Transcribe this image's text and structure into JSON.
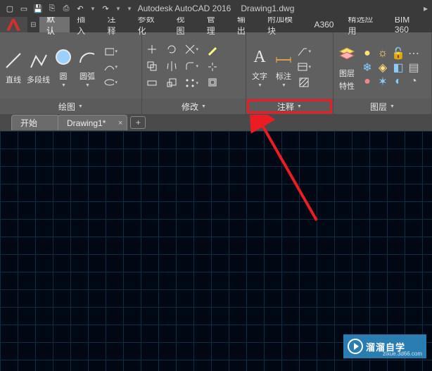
{
  "titlebar": {
    "app": "Autodesk AutoCAD 2016",
    "file": "Drawing1.dwg"
  },
  "menus": {
    "default": "默认",
    "insert": "插入",
    "annotate": "注释",
    "param": "参数化",
    "view": "视图",
    "manage": "管理",
    "output": "输出",
    "addon": "附加模块",
    "a360": "A360",
    "featured": "精选应用",
    "bim360": "BIM 360"
  },
  "ribbon": {
    "draw": {
      "line": "直线",
      "polyline": "多段线",
      "circle": "圆",
      "arc": "圆弧",
      "panel": "绘图"
    },
    "modify": {
      "panel": "修改"
    },
    "annotation": {
      "text": "文字",
      "dim": "标注",
      "panel": "注释"
    },
    "layer": {
      "label": "图层",
      "prop": "特性",
      "panel": "图层"
    }
  },
  "doctabs": {
    "start": "开始",
    "drawing": "Drawing1*"
  },
  "watermark": {
    "title": "溜溜自学",
    "sub": "zixue.3d66.com"
  }
}
